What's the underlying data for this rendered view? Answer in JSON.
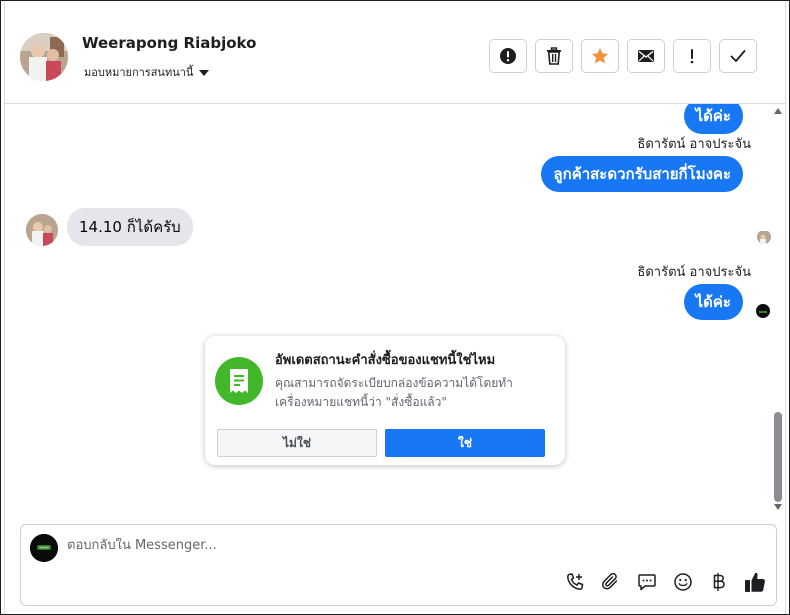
{
  "header": {
    "contact_name": "Weerapong Riabjoko",
    "assign_label": "มอบหมายการสนทนานี้",
    "actions": [
      "alert-icon",
      "trash-icon",
      "star-icon",
      "mail-icon",
      "exclamation-icon",
      "check-icon"
    ]
  },
  "messages": [
    {
      "direction": "out",
      "text": "ได้ค่ะ"
    },
    {
      "direction": "out",
      "sender": "ธิดารัตน์ อาจประจัน",
      "text": "ลูกค้าสะดวกรับสายกี่โมงคะ"
    },
    {
      "direction": "in",
      "text": "14.10 ก็ได้ครับ"
    },
    {
      "direction": "out",
      "sender": "ธิดารัตน์ อาจประจัน",
      "text": "ได้ค่ะ"
    }
  ],
  "order_card": {
    "title": "อัพเดตสถานะคำสั่งซื้อของแชทนี้ใช่ไหม",
    "body": "คุณสามารถจัดระเบียบกล่องข้อความได้โดยทำเครื่องหมายแชทนี้ว่า \"สั่งซื้อแล้ว\"",
    "no_label": "ไม่ใช่",
    "yes_label": "ใช่"
  },
  "composer": {
    "placeholder": "ตอบกลับใน Messenger...",
    "tools": [
      "call-add-icon",
      "attachment-icon",
      "quick-reply-icon",
      "emoji-icon",
      "baht-icon",
      "like-icon"
    ]
  },
  "colors": {
    "accent": "#1877f2",
    "bubble_in": "#e4e6eb",
    "card_icon": "#42b72a",
    "star": "#f7923b"
  }
}
